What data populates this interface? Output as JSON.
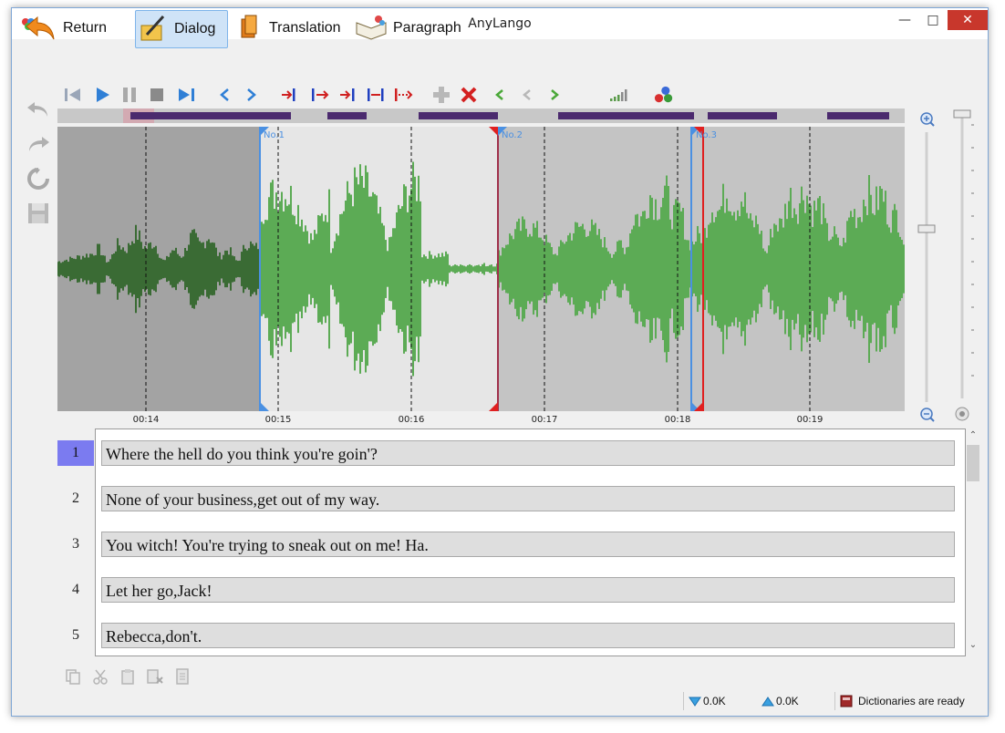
{
  "window": {
    "title": "AnyLango"
  },
  "modes": [
    {
      "label": "Return",
      "icon": "return-arrow-icon"
    },
    {
      "label": "Dialog",
      "icon": "dialog-pen-icon",
      "active": true
    },
    {
      "label": "Translation",
      "icon": "translation-book-icon"
    },
    {
      "label": "Paragraph",
      "icon": "paragraph-book-icon"
    }
  ],
  "waveform": {
    "markers": [
      {
        "label": "No.1",
        "color": "#4a90e2"
      },
      {
        "label": "No.2",
        "color": "#e02020"
      },
      {
        "label": "No.3",
        "color": "#4a90e2"
      }
    ],
    "ticks": [
      "00:14",
      "00:15",
      "00:16",
      "00:17",
      "00:18",
      "00:19"
    ]
  },
  "sentences": [
    {
      "num": "1",
      "text": "Where the hell do you think you're goin'?",
      "selected": true
    },
    {
      "num": "2",
      "text": "None of your business,get out of my way."
    },
    {
      "num": "3",
      "text": "You witch! You're trying to sneak out on me! Ha."
    },
    {
      "num": "4",
      "text": "Let her go,Jack!"
    },
    {
      "num": "5",
      "text": "Rebecca,don't."
    }
  ],
  "status": {
    "download": "0.0K",
    "upload": "0.0K",
    "dictionaries": "Dictionaries are ready"
  },
  "colors": {
    "wave_dark": "#3a6b34",
    "wave_light": "#5cab55",
    "selected_row": "#7b7bf0",
    "accent": "#4a90e2"
  }
}
